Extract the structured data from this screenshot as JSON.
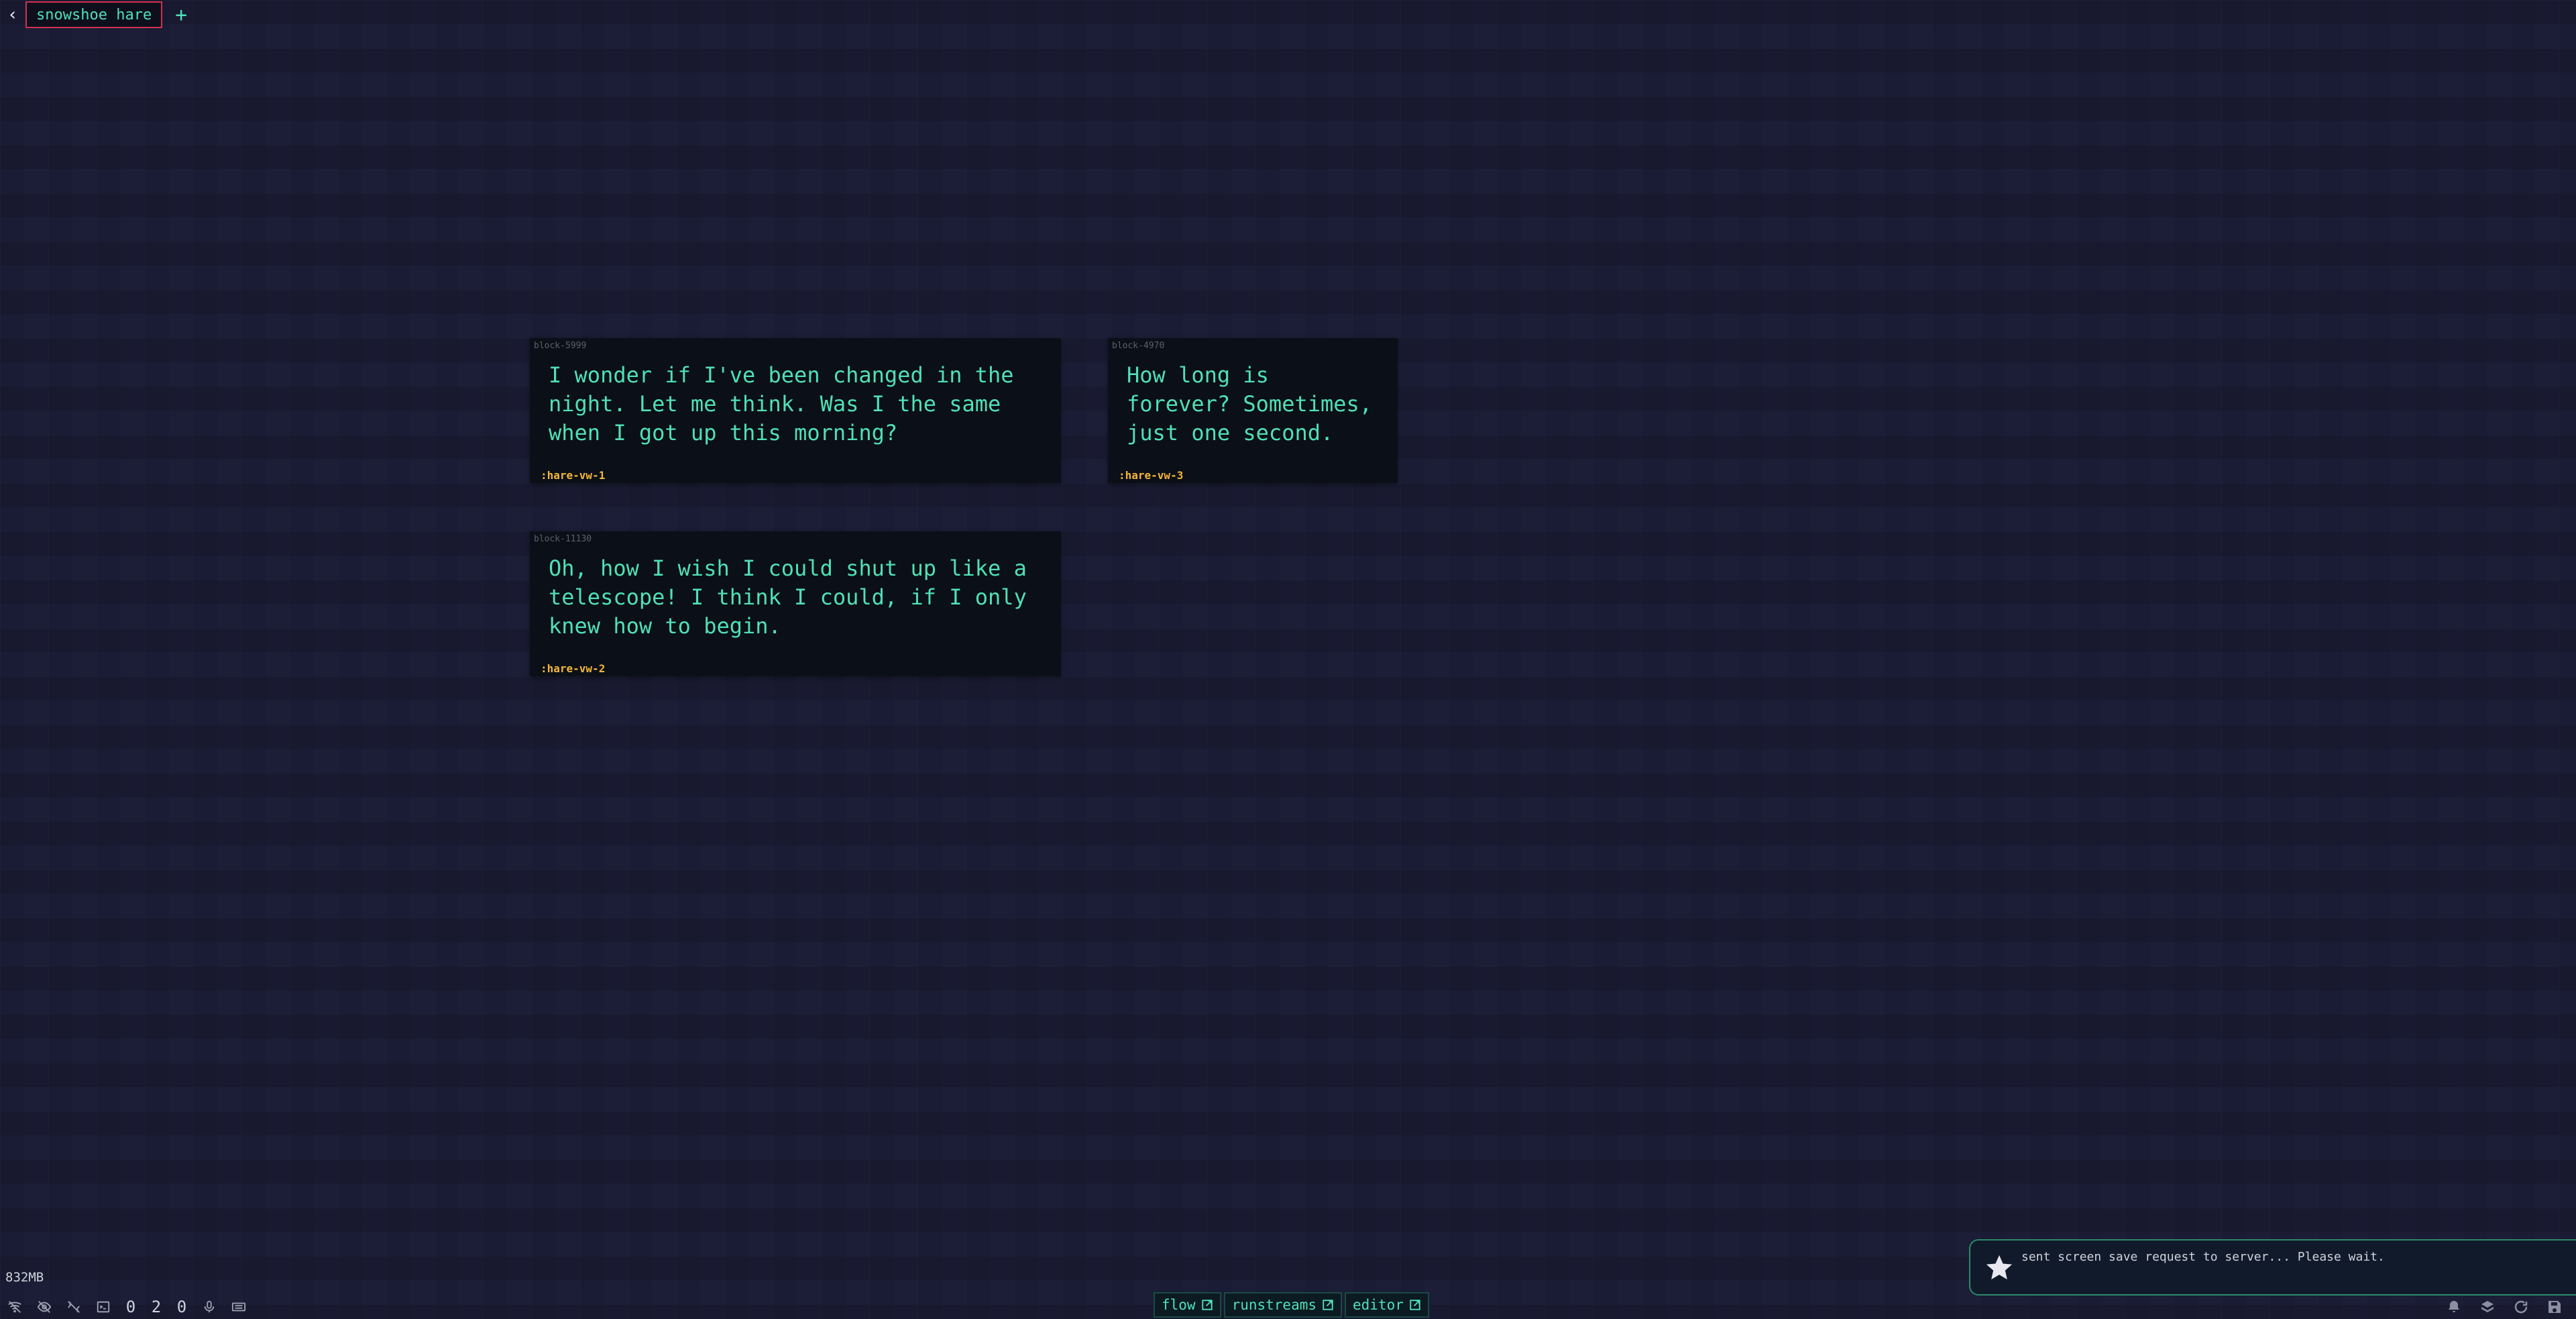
{
  "tabs": {
    "back_icon": "chevron-left-icon",
    "active_label": "snowshoe hare",
    "add_label": "+"
  },
  "blocks": [
    {
      "id": "block-5999",
      "text": "I wonder if I've been changed in the night. Let me think. Was I the same when I got up this morning?",
      "tag": ":hare-vw-1"
    },
    {
      "id": "block-4970",
      "text": "How long is forever? Sometimes, just one second.",
      "tag": ":hare-vw-3"
    },
    {
      "id": "block-11130",
      "text": "Oh, how I wish I could shut up like a telescope! I think I could, if I only knew how to begin.",
      "tag": ":hare-vw-2"
    }
  ],
  "memory": "832MB",
  "status": {
    "counts": [
      "0",
      "2",
      "0"
    ],
    "icons": [
      "wifi-off-icon",
      "eye-off-icon",
      "network-off-icon",
      "terminal-icon",
      "microphone-icon",
      "keyboard-icon"
    ]
  },
  "views": [
    {
      "label": "flow",
      "icon": "external-window-icon"
    },
    {
      "label": "runstreams",
      "icon": "external-window-icon"
    },
    {
      "label": "editor",
      "icon": "external-window-icon"
    }
  ],
  "notification": {
    "icon": "star-icon",
    "message": "sent screen save request to server... Please wait."
  },
  "bottom_right_icons": [
    "bell-icon",
    "layers-icon",
    "refresh-icon",
    "save-icon"
  ],
  "colors": {
    "background": "#1c1d37",
    "accent": "#4fe0b8",
    "tag": "#f5b73a",
    "tab_border": "#d03050"
  }
}
